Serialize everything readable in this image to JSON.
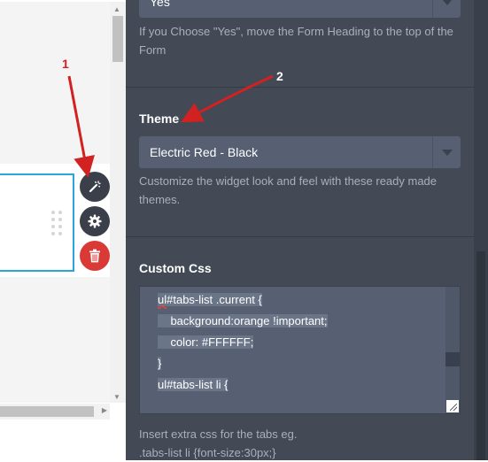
{
  "annotations": {
    "one": "1",
    "two": "2"
  },
  "move_heading": {
    "selected": "Yes",
    "help": "If you Choose \"Yes\", move the Form Heading to the top of the Form"
  },
  "theme": {
    "label": "Theme",
    "selected": "Electric Red - Black",
    "help": "Customize the widget look and feel with these ready made themes."
  },
  "custom_css": {
    "label": "Custom Css",
    "lines": [
      "ul#tabs-list .current {",
      "    background:orange !important;",
      "    color: #FFFFFF;",
      "}",
      "",
      "ul#tabs-list li {"
    ],
    "help_line1": "Insert extra css for the tabs eg.",
    "help_line2": ".tabs-list li {font-size:30px;}"
  },
  "icons": {
    "wand": "magic-wand-icon",
    "gear": "gear-icon",
    "trash": "trash-icon"
  },
  "colors": {
    "panel": "#434a56",
    "field": "#566072",
    "accent_blue": "#2aa7d9",
    "delete_red": "#d93a36",
    "annotation_red": "#d22121"
  }
}
